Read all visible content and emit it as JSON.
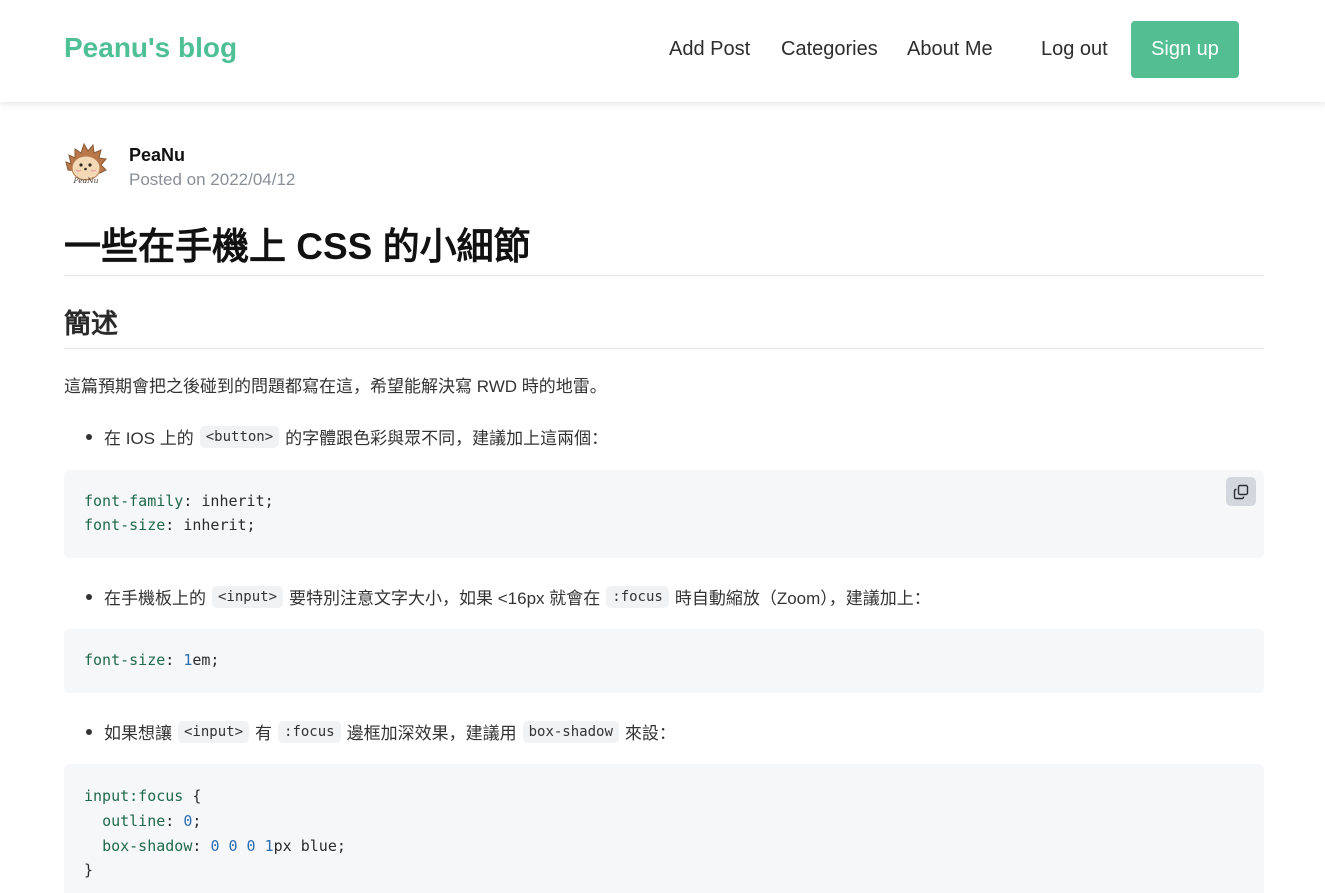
{
  "header": {
    "brand": "Peanu's blog",
    "nav": [
      "Add Post",
      "Categories",
      "About Me",
      "Log out"
    ],
    "signup_label": "Sign up"
  },
  "post": {
    "author": "PeaNu",
    "avatar_text": "PeaNu",
    "date": "Posted on 2022/04/12",
    "title": "一些在手機上 CSS 的小細節",
    "section_title": "簡述",
    "intro": "這篇預期會把之後碰到的問題都寫在這，希望能解決寫 RWD 時的地雷。",
    "bullets": [
      {
        "before": "在 IOS 上的",
        "code1": "<button>",
        "after": "的字體跟色彩與眾不同，建議加上這兩個："
      },
      {
        "before": "在手機板上的",
        "code1": "<input>",
        "middle": "要特別注意文字大小，如果 <16px 就會在",
        "code2": ":focus",
        "after": "時自動縮放（Zoom），建議加上："
      },
      {
        "before": "如果想讓",
        "code1": "<input>",
        "middle1": "有",
        "code2": ":focus",
        "middle2": "邊框加深效果，建議用",
        "code3": "box-shadow",
        "after": "來設："
      }
    ],
    "code_blocks": [
      {
        "lines": [
          {
            "prop": "font-family",
            "rest": ": inherit;"
          },
          {
            "prop": "font-size",
            "rest": ": inherit;"
          }
        ]
      },
      {
        "lines": [
          {
            "prop": "font-size",
            "punct": ": ",
            "num": "1",
            "rest": "em;"
          }
        ]
      },
      {
        "lines": [
          {
            "prop": "input:focus",
            "rest": " {"
          },
          {
            "indent": "  ",
            "prop": "outline",
            "punct": ": ",
            "num": "0",
            "rest": ";"
          },
          {
            "indent": "  ",
            "prop": "box-shadow",
            "punct": ": ",
            "num": "0 0 0 1",
            "rest": "px blue;"
          },
          {
            "rest": "}"
          }
        ]
      }
    ]
  },
  "colors": {
    "brand": "#4fbf95",
    "signup_bg": "#54be93",
    "code_bg": "#f6f7f9",
    "code_prop": "#1f6a4a",
    "code_number": "#2a6db0"
  },
  "icons": {
    "copy": "copy-icon",
    "avatar": "hedgehog-avatar"
  }
}
